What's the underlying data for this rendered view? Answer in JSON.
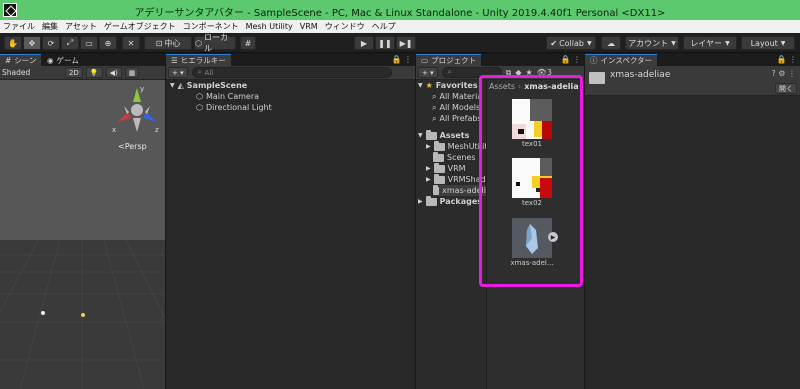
{
  "window": {
    "title": "アデリーサンタアバター - SampleScene - PC, Mac & Linux Standalone - Unity 2019.4.40f1 Personal <DX11>",
    "titlebar_color": "#5cc96f"
  },
  "menu": [
    "ファイル",
    "編集",
    "アセット",
    "ゲームオブジェクト",
    "コンポーネント",
    "Mesh Utility",
    "VRM",
    "ウィンドウ",
    "ヘルプ"
  ],
  "toolbar": {
    "tools": [
      "hand-icon",
      "move-icon",
      "rotate-icon",
      "scale-icon",
      "rect-icon",
      "transform-icon",
      "custom-tool-icon"
    ],
    "pivot_label": "中心",
    "space_label": "ローカル",
    "play_controls": [
      "play-icon",
      "pause-icon",
      "step-icon"
    ],
    "collab_label": "Collab",
    "account_label": "アカウント",
    "layers_label": "レイヤー",
    "layout_label": "Layout"
  },
  "scene": {
    "tabs": [
      "シーン",
      "ゲーム"
    ],
    "shading_mode": "Shaded",
    "mode_2d": "2D",
    "gizmo_axes": [
      "y",
      "x",
      "z"
    ],
    "projection_label": "Persp"
  },
  "hierarchy": {
    "tab": "ヒエラルキー",
    "search_placeholder": "All",
    "scene_name": "SampleScene",
    "objects": [
      "Main Camera",
      "Directional Light"
    ]
  },
  "project": {
    "tab": "プロジェクト",
    "asset_count": "3",
    "favorites": {
      "label": "Favorites",
      "items": [
        "All Materia",
        "All Models",
        "All Prefabs"
      ]
    },
    "assets": {
      "label": "Assets",
      "folders": [
        "MeshUtility",
        "Scenes",
        "VRM",
        "VRMShade",
        "xmas-adeli"
      ]
    },
    "packages_label": "Packages",
    "breadcrumb": [
      "Assets",
      "xmas-adelia"
    ],
    "files": [
      {
        "name": "tex01"
      },
      {
        "name": "tex02"
      },
      {
        "name": "xmas-adel..."
      }
    ],
    "highlight_color": "#e81ce0"
  },
  "inspector": {
    "tab": "インスペクター",
    "object_name": "xmas-adeliae",
    "open_button": "開く"
  }
}
